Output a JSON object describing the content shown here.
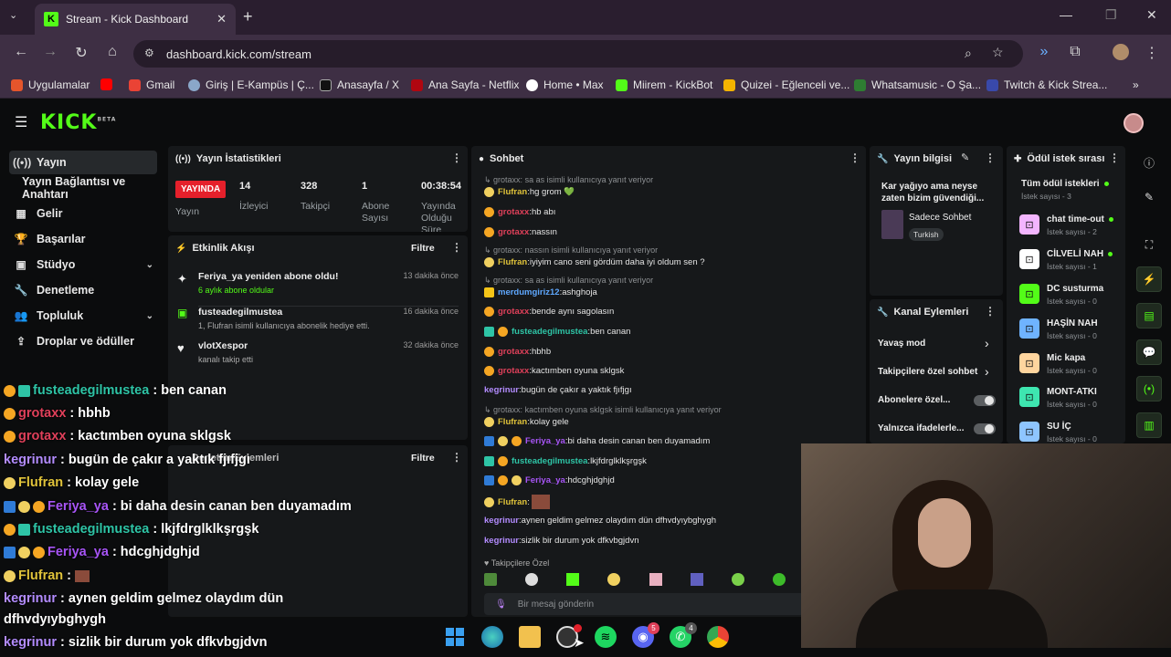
{
  "browser": {
    "tab_title": "Stream - Kick Dashboard",
    "url": "dashboard.kick.com/stream",
    "bookmarks": [
      "Uygulamalar",
      "Gmail",
      "Giriş | E-Kampüs | Ç...",
      "Anasayfa / X",
      "Ana Sayfa - Netflix",
      "Home • Max",
      "Miirem - KickBot",
      "Quizei - Eğlenceli ve...",
      "Whatsamusic - O Şa...",
      "Twitch & Kick Strea..."
    ]
  },
  "header": {
    "logo": "KICK",
    "logo_sup": "BETA"
  },
  "sidebar": {
    "items": [
      {
        "label": "Yayın",
        "icon": "broadcast-icon"
      },
      {
        "label": "Yayın Bağlantısı ve Anahtarı",
        "icon": ""
      },
      {
        "label": "Gelir",
        "icon": "revenue-icon"
      },
      {
        "label": "Başarılar",
        "icon": "trophy-icon"
      },
      {
        "label": "Stüdyo",
        "icon": "studio-icon"
      },
      {
        "label": "Denetleme",
        "icon": "moderation-icon"
      },
      {
        "label": "Topluluk",
        "icon": "community-icon"
      },
      {
        "label": "Droplar ve ödüller",
        "icon": "drops-icon"
      }
    ]
  },
  "stats": {
    "title": "Yayın İstatistikleri",
    "live_badge": "YAYINDA",
    "live_label": "Yayın",
    "viewers_value": "14",
    "viewers_label": "İzleyici",
    "followers_value": "328",
    "followers_label": "Takipçi",
    "subs_value": "1",
    "subs_label": "Abone Sayısı",
    "uptime_value": "00:38:54",
    "uptime_label": "Yayında Olduğu Süre"
  },
  "activity": {
    "title": "Etkinlik Akışı",
    "filter": "Filtre",
    "items": [
      {
        "name": "Feriya_ya yeniden abone oldu!",
        "sub": "6 aylık abone oldular",
        "time": "13 dakika önce"
      },
      {
        "name": "fusteadegilmustea",
        "sub": "1, Flufran isimli kullanıcıya abonelik hediye etti.",
        "time": "16 dakika önce"
      },
      {
        "name": "vlotXespor",
        "sub": "kanalı takip etti",
        "time": "32 dakika önce"
      }
    ]
  },
  "modlog": {
    "title": "Denetim Eylemleri",
    "filter": "Filtre"
  },
  "chat": {
    "title": "Sohbet",
    "followers_only": "Takipçilere Özel",
    "input_placeholder": "Bir mesaj gönderin",
    "lines": [
      {
        "reply": "sa as isimli kullanıcıya yanıt veriyor",
        "user": "Flufran",
        "color": "#e0c33a",
        "text": "hg grom 💚"
      },
      {
        "user": "grotaxx",
        "color": "#e0405a",
        "text": "hb abı"
      },
      {
        "user": "grotaxx",
        "color": "#e0405a",
        "text": "nassın"
      },
      {
        "reply": "nassın isimli kullanıcıya yanıt veriyor",
        "user": "Flufran",
        "color": "#e0c33a",
        "text": "iyiyim cano seni gördüm daha iyi oldum sen ?"
      },
      {
        "reply": "sa as isimli kullanıcıya yanıt veriyor",
        "user": "merdumgiriz12",
        "color": "#5fa8ff",
        "text": "ashghoja"
      },
      {
        "user": "grotaxx",
        "color": "#e0405a",
        "text": "bende aynı sagolasın"
      },
      {
        "user": "fusteadegilmustea",
        "color": "#2ec4a6",
        "text": "ben canan"
      },
      {
        "user": "grotaxx",
        "color": "#e0405a",
        "text": "hbhb"
      },
      {
        "user": "grotaxx",
        "color": "#e0405a",
        "text": "kactımben oyuna sklgsk"
      },
      {
        "user": "kegrinur",
        "color": "#b38cff",
        "text": "bugün de çakır a yaktık fjıfjgı"
      },
      {
        "reply": "kactımben oyuna sklgsk isimli kullanıcıya yanıt veriyor",
        "user": "Flufran",
        "color": "#e0c33a",
        "text": "kolay gele"
      },
      {
        "user": "Feriya_ya",
        "color": "#a855f7",
        "text": "bi daha desin canan ben duyamadım"
      },
      {
        "user": "fusteadegilmustea",
        "color": "#2ec4a6",
        "text": "lkjfdrglklkşrgşk"
      },
      {
        "user": "Feriya_ya",
        "color": "#a855f7",
        "text": "hdcghjdghjd"
      },
      {
        "user": "Flufran",
        "color": "#e0c33a",
        "text": ""
      },
      {
        "user": "kegrinur",
        "color": "#b38cff",
        "text": "aynen geldim gelmez olaydım dün dfhvdyıybghygh"
      },
      {
        "user": "kegrinur",
        "color": "#b38cff",
        "text": "sizlik bir durum yok dfkvbgjdvn"
      }
    ]
  },
  "stream_info": {
    "title": "Yayın bilgisi",
    "stream_title": "Kar yağıyo ama neyse zaten bizim güvendiği...",
    "category": "Sadece Sohbet",
    "language": "Turkish"
  },
  "channel_actions": {
    "title": "Kanal Eylemleri",
    "items": [
      "Yavaş mod",
      "Takipçilere özel sohbet",
      "Abonelere özel...",
      "Yalnızca ifadelerle..."
    ]
  },
  "rewards": {
    "title": "Ödül istek sırası",
    "all_label": "Tüm ödül istekleri",
    "all_count": "İstek sayısı - 3",
    "items": [
      {
        "name": "chat time-out",
        "count": "İstek sayısı - 2",
        "color": "#f3b5ff",
        "active": true
      },
      {
        "name": "CİLVELİ NAH",
        "count": "İstek sayısı - 1",
        "color": "#ffffff",
        "active": true
      },
      {
        "name": "DC susturma",
        "count": "İstek sayısı - 0",
        "color": "#53fc18",
        "active": false
      },
      {
        "name": "HAŞİN NAH",
        "count": "İstek sayısı - 0",
        "color": "#6fb3ff",
        "active": false
      },
      {
        "name": "Mic kapa",
        "count": "İstek sayısı - 0",
        "color": "#ffd59e",
        "active": false
      },
      {
        "name": "MONT-ATKI",
        "count": "İstek sayısı - 0",
        "color": "#3ee6b0",
        "active": false
      },
      {
        "name": "SU İÇ",
        "count": "İstek sayısı - 0",
        "color": "#8ec5ff",
        "active": false
      }
    ]
  },
  "overlay_chat": [
    {
      "user": "fusteadegilmustea",
      "color": "#2ec4a6",
      "text": ": ben canan"
    },
    {
      "user": "grotaxx",
      "color": "#e0405a",
      "text": ": hbhb"
    },
    {
      "user": "grotaxx",
      "color": "#e0405a",
      "text": ": kactımben oyuna sklgsk"
    },
    {
      "user": "kegrinur",
      "color": "#b38cff",
      "text": ": bugün de çakır a yaktık fjıfjgı"
    },
    {
      "user": "Flufran",
      "color": "#e0c33a",
      "text": ": kolay gele"
    },
    {
      "user": "Feriya_ya",
      "color": "#a855f7",
      "text": ": bi daha desin canan ben duyamadım"
    },
    {
      "user": "fusteadegilmustea",
      "color": "#2ec4a6",
      "text": ": lkjfdrglklkşrgşk"
    },
    {
      "user": "Feriya_ya",
      "color": "#a855f7",
      "text": ": hdcghjdghjd"
    },
    {
      "user": "Flufran",
      "color": "#e0c33a",
      "text": ":"
    },
    {
      "user": "kegrinur",
      "color": "#b38cff",
      "text": ": aynen geldim gelmez olaydım dün"
    },
    {
      "user": "",
      "color": "#ffffff",
      "text": "dfhvdyıybghygh"
    },
    {
      "user": "kegrinur",
      "color": "#b38cff",
      "text": ": sizlik bir durum yok dfkvbgjdvn"
    }
  ],
  "taskbar": {
    "discord_badge": "5",
    "whatsapp_badge": "4"
  },
  "colors": {
    "kick_green": "#53fc18",
    "live_red": "#e5202b"
  }
}
